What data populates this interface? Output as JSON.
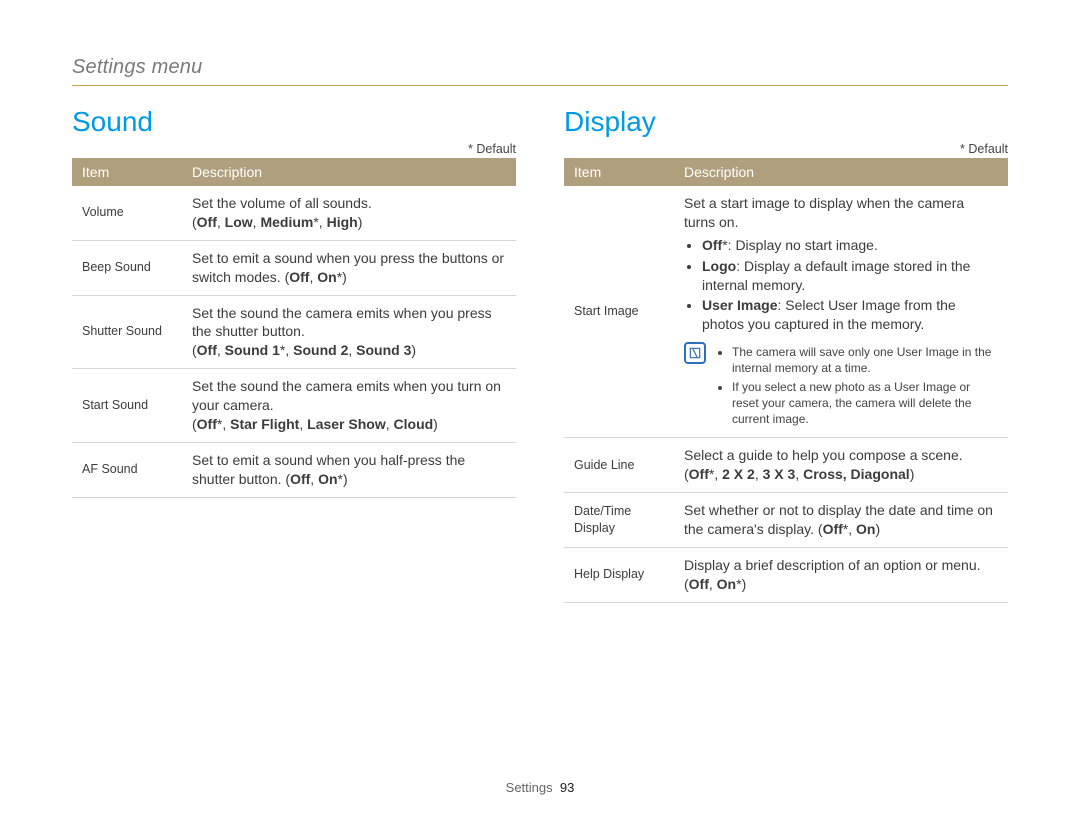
{
  "breadcrumb": "Settings menu",
  "default_note": "* Default",
  "table_headers": {
    "item": "Item",
    "description": "Description"
  },
  "sound": {
    "title": "Sound",
    "rows": [
      {
        "item": "Volume",
        "desc": "Set the volume of all sounds.",
        "options_html": "(<b>Off</b>, <b>Low</b>, <b>Medium</b>*, <b>High</b>)"
      },
      {
        "item": "Beep Sound",
        "desc": "Set to emit a sound when you press the buttons or switch modes. (<b>Off</b>, <b>On</b>*)",
        "options_html": ""
      },
      {
        "item": "Shutter Sound",
        "desc": "Set the sound the camera emits when you press the shutter button.",
        "options_html": "(<b>Off</b>, <b>Sound 1</b>*, <b>Sound 2</b>, <b>Sound 3</b>)"
      },
      {
        "item": "Start Sound",
        "desc": "Set the sound the camera emits when you turn on your camera.",
        "options_html": "(<b>Off</b>*, <b>Star Flight</b>, <b>Laser Show</b>, <b>Cloud</b>)"
      },
      {
        "item": "AF Sound",
        "desc": "Set to emit a sound when you half-press the shutter button. (<b>Off</b>, <b>On</b>*)",
        "options_html": ""
      }
    ]
  },
  "display": {
    "title": "Display",
    "rows": [
      {
        "item": "Start Image",
        "desc": "Set a start image to display when the camera turns on.",
        "bullets": [
          "<b>Off</b>*: Display no start image.",
          "<b>Logo</b>: Display a default image stored in the internal memory.",
          "<b>User Image</b>: Select User Image from the photos you captured in the memory."
        ],
        "notes": [
          "The camera will save only one User Image in the internal memory at a time.",
          "If you select a new photo as a User Image or reset your camera, the camera will delete the current image."
        ]
      },
      {
        "item": "Guide Line",
        "desc": "Select a guide to help you compose a scene.",
        "options_html": "(<b>Off</b>*, <b>2 X 2</b>, <b>3 X 3</b>, <b>Cross, Diagonal</b>)"
      },
      {
        "item": "Date/Time Display",
        "desc": "Set whether or not to display the date and time on the camera's display. (<b>Off</b>*, <b>On</b>)",
        "options_html": ""
      },
      {
        "item": "Help Display",
        "desc": "Display a brief description of an option or menu.",
        "options_html": "(<b>Off</b>, <b>On</b>*)"
      }
    ]
  },
  "footer": {
    "section": "Settings",
    "page": "93"
  }
}
